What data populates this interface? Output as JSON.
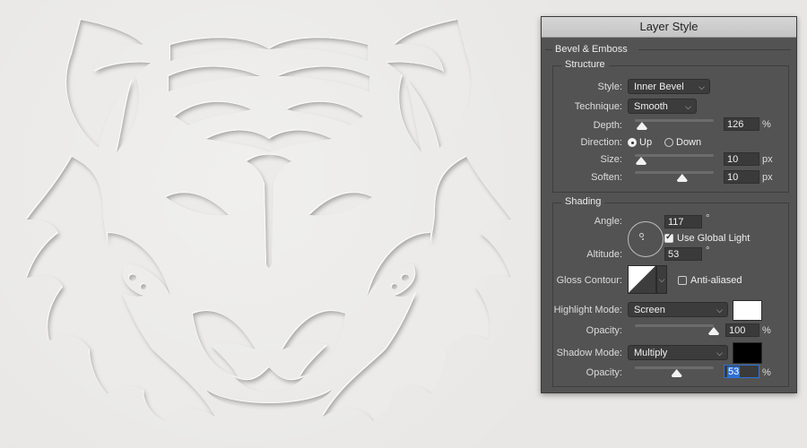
{
  "window": {
    "title": "Layer Style"
  },
  "bevel_emboss": {
    "section_title": "Bevel & Emboss",
    "structure": {
      "group_title": "Structure",
      "style": {
        "label": "Style:",
        "value": "Inner Bevel"
      },
      "technique": {
        "label": "Technique:",
        "value": "Smooth"
      },
      "depth": {
        "label": "Depth:",
        "value": "126",
        "unit": "%",
        "slider_fraction": 0.09
      },
      "direction": {
        "label": "Direction:",
        "options": [
          "Up",
          "Down"
        ],
        "selected": "Up"
      },
      "size": {
        "label": "Size:",
        "value": "10",
        "unit": "px",
        "slider_fraction": 0.08
      },
      "soften": {
        "label": "Soften:",
        "value": "10",
        "unit": "px",
        "slider_fraction": 0.6
      }
    },
    "shading": {
      "group_title": "Shading",
      "angle": {
        "label": "Angle:",
        "value": "117",
        "unit": "°"
      },
      "use_global_light": {
        "label": "Use Global Light",
        "checked": true
      },
      "altitude": {
        "label": "Altitude:",
        "value": "53",
        "unit": "°"
      },
      "gloss_contour": {
        "label": "Gloss Contour:"
      },
      "anti_aliased": {
        "label": "Anti-aliased",
        "checked": false
      },
      "highlight_mode": {
        "label": "Highlight Mode:",
        "value": "Screen",
        "color": "#ffffff"
      },
      "highlight_opacity": {
        "label": "Opacity:",
        "value": "100",
        "unit": "%",
        "slider_fraction": 1.0
      },
      "shadow_mode": {
        "label": "Shadow Mode:",
        "value": "Multiply",
        "color": "#000000"
      },
      "shadow_opacity": {
        "label": "Opacity:",
        "value": "53",
        "unit": "%",
        "slider_fraction": 0.53
      }
    }
  },
  "canvas": {
    "artwork": "embossed-tiger-head"
  }
}
